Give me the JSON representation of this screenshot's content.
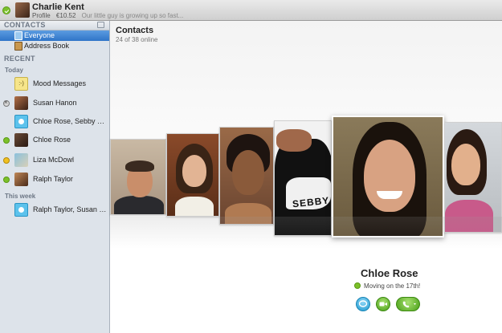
{
  "profile": {
    "name": "Charlie Kent",
    "profile_label": "Profile",
    "balance": "€10.52",
    "mood": "Our little guy is growing up so fast..."
  },
  "sidebar": {
    "contacts_header": "CONTACTS",
    "groups": [
      {
        "label": "Everyone",
        "selected": true
      },
      {
        "label": "Address Book",
        "selected": false
      }
    ],
    "recent_header": "RECENT",
    "today_label": "Today",
    "this_week_label": "This week",
    "mood_messages_label": "Mood Messages",
    "recent_today": [
      {
        "label": "Susan Hanon",
        "status": "offline"
      },
      {
        "label": "Chloe Rose, Sebby Sau...",
        "status": "none"
      },
      {
        "label": "Chloe Rose",
        "status": "online"
      },
      {
        "label": "Liza McDowl",
        "status": "away"
      },
      {
        "label": "Ralph Taylor",
        "status": "online"
      }
    ],
    "recent_week": [
      {
        "label": "Ralph Taylor, Susan Ha...",
        "status": "none"
      }
    ],
    "mood_icon_text": ":-)"
  },
  "main": {
    "title": "Contacts",
    "online_count": "24 of 38 online",
    "featured_name": "Chloe Rose",
    "featured_mood": "Moving on the 17th!",
    "card_shirt_text": "SEBBY"
  },
  "colors": {
    "online": "#7cc02a",
    "away": "#f0c020",
    "selection": "#2f74c8",
    "chat": "#1e9ad0",
    "call": "#4aa018"
  }
}
